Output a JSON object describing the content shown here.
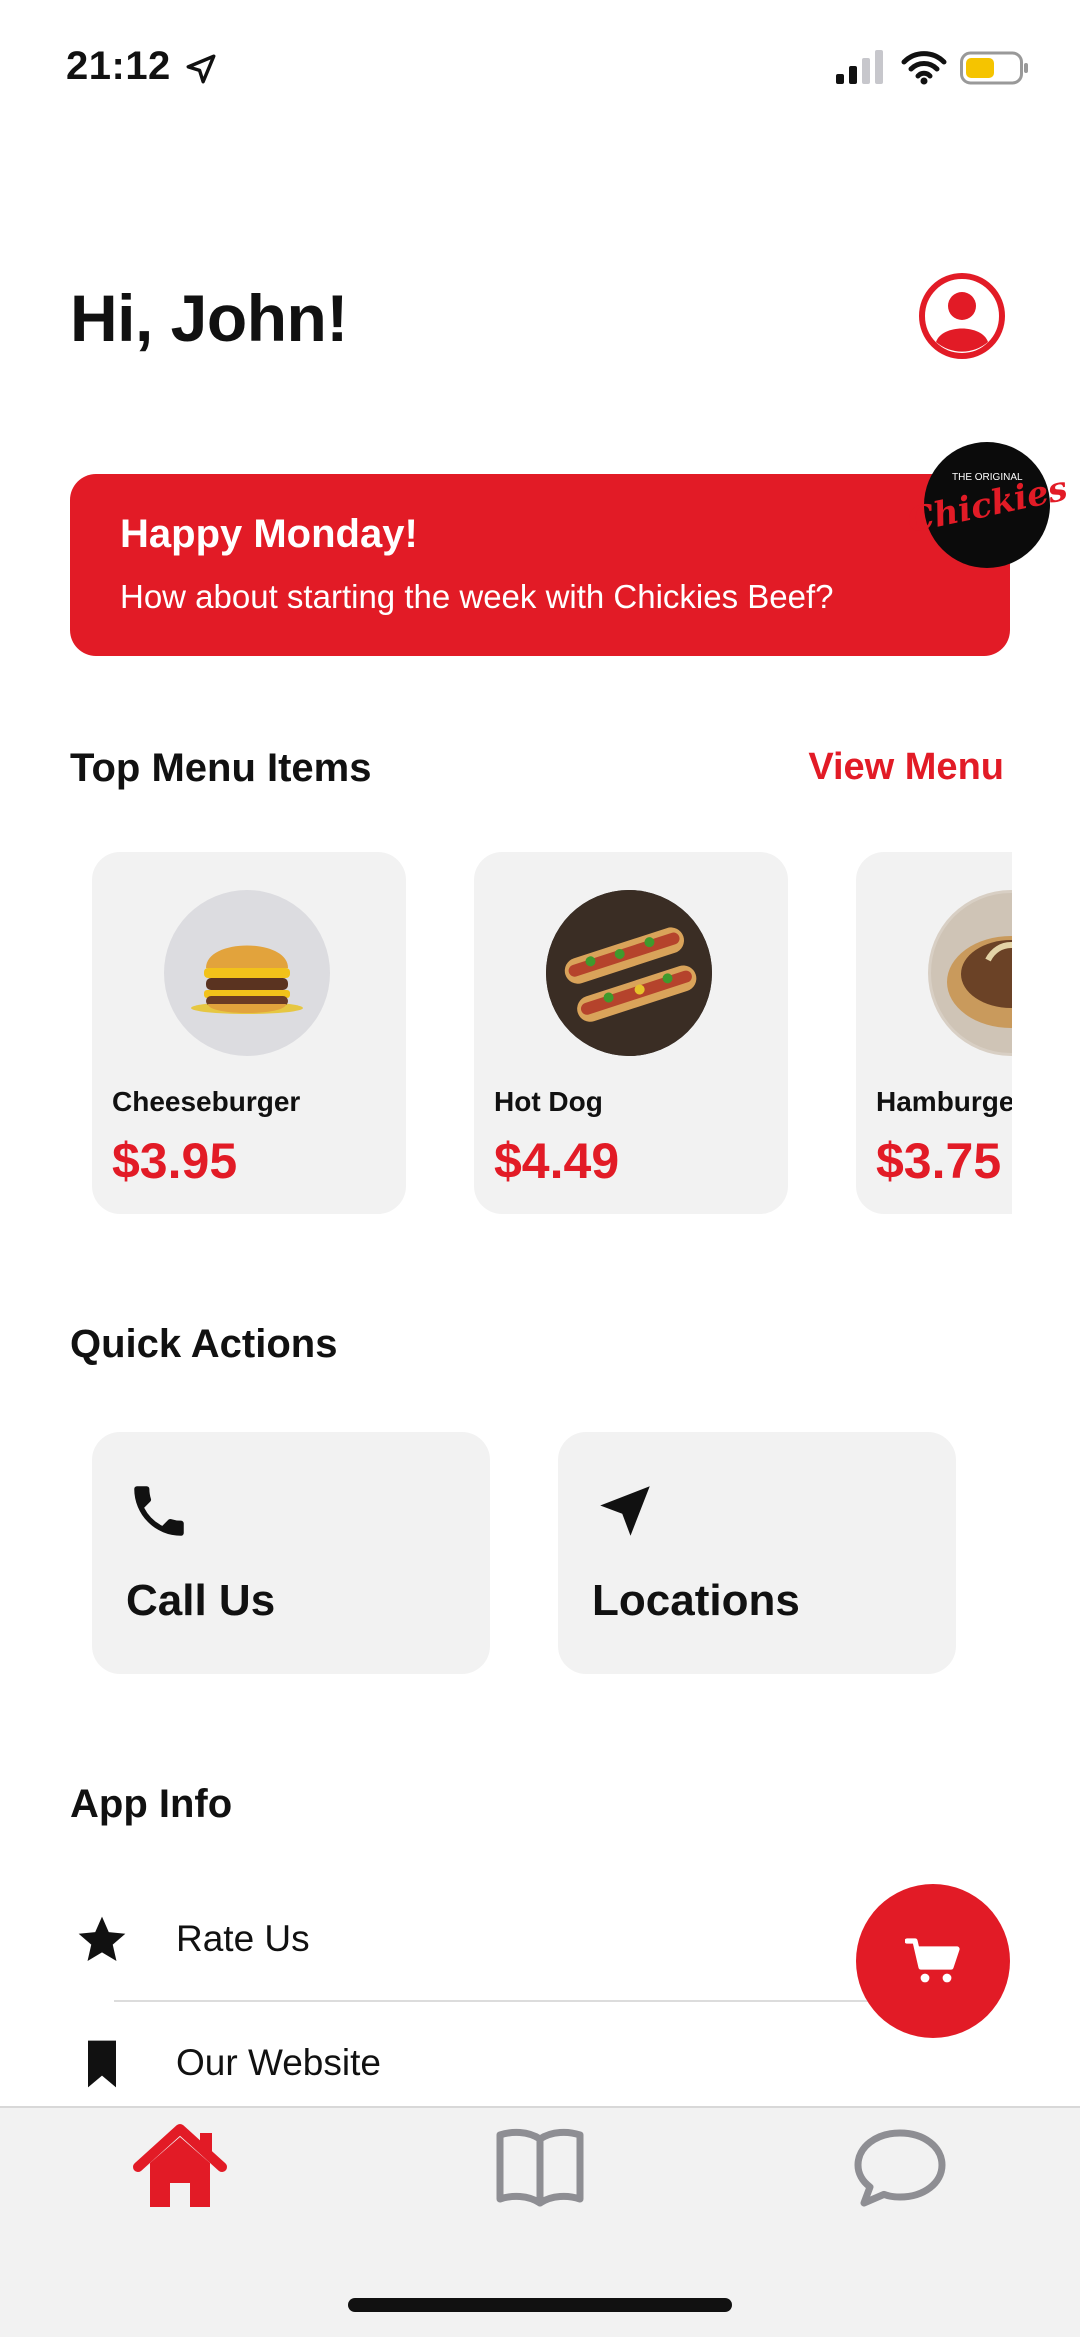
{
  "status_bar": {
    "time": "21:12",
    "icons": [
      "location-arrow-icon",
      "cellular-signal-icon",
      "wifi-icon",
      "battery-icon"
    ],
    "battery_color": "#f5c400"
  },
  "header": {
    "greeting": "Hi, John!",
    "profile_icon": "user-circle-icon"
  },
  "promo": {
    "title": "Happy Monday!",
    "subtitle": "How about starting the week with Chickies Beef?",
    "logo_text": "Chickies",
    "logo_small": "THE ORIGINAL",
    "background": "#e21b26"
  },
  "top_menu": {
    "title": "Top Menu Items",
    "view_menu_label": "View Menu",
    "items": [
      {
        "name": "Cheeseburger",
        "price": "$3.95"
      },
      {
        "name": "Hot Dog",
        "price": "$4.49"
      },
      {
        "name": "Hamburger",
        "price": "$3.75"
      }
    ]
  },
  "quick_actions": {
    "title": "Quick Actions",
    "items": [
      {
        "label": "Call Us",
        "icon": "phone-icon"
      },
      {
        "label": "Locations",
        "icon": "navigation-arrow-icon"
      }
    ]
  },
  "app_info": {
    "title": "App Info",
    "items": [
      {
        "label": "Rate Us",
        "icon": "star-icon"
      },
      {
        "label": "Our Website",
        "icon": "bookmark-icon"
      }
    ]
  },
  "cart": {
    "icon": "cart-icon"
  },
  "tab_bar": {
    "tabs": [
      {
        "icon": "home-icon",
        "active": true
      },
      {
        "icon": "book-icon",
        "active": false
      },
      {
        "icon": "chat-bubble-icon",
        "active": false
      }
    ]
  },
  "colors": {
    "accent": "#e21b26",
    "card_bg": "#f2f2f2",
    "inactive_icon": "#8e8e93"
  }
}
